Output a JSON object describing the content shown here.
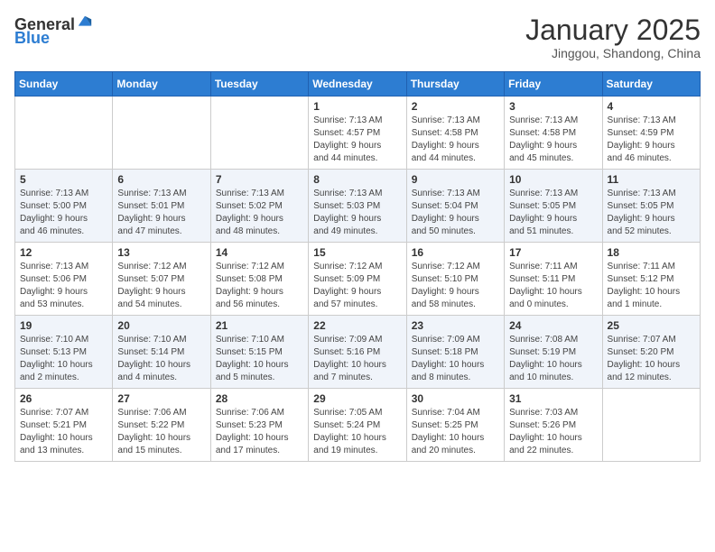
{
  "header": {
    "logo_general": "General",
    "logo_blue": "Blue",
    "month_title": "January 2025",
    "location": "Jinggou, Shandong, China"
  },
  "days_of_week": [
    "Sunday",
    "Monday",
    "Tuesday",
    "Wednesday",
    "Thursday",
    "Friday",
    "Saturday"
  ],
  "weeks": [
    [
      {
        "day": "",
        "info": ""
      },
      {
        "day": "",
        "info": ""
      },
      {
        "day": "",
        "info": ""
      },
      {
        "day": "1",
        "info": "Sunrise: 7:13 AM\nSunset: 4:57 PM\nDaylight: 9 hours\nand 44 minutes."
      },
      {
        "day": "2",
        "info": "Sunrise: 7:13 AM\nSunset: 4:58 PM\nDaylight: 9 hours\nand 44 minutes."
      },
      {
        "day": "3",
        "info": "Sunrise: 7:13 AM\nSunset: 4:58 PM\nDaylight: 9 hours\nand 45 minutes."
      },
      {
        "day": "4",
        "info": "Sunrise: 7:13 AM\nSunset: 4:59 PM\nDaylight: 9 hours\nand 46 minutes."
      }
    ],
    [
      {
        "day": "5",
        "info": "Sunrise: 7:13 AM\nSunset: 5:00 PM\nDaylight: 9 hours\nand 46 minutes."
      },
      {
        "day": "6",
        "info": "Sunrise: 7:13 AM\nSunset: 5:01 PM\nDaylight: 9 hours\nand 47 minutes."
      },
      {
        "day": "7",
        "info": "Sunrise: 7:13 AM\nSunset: 5:02 PM\nDaylight: 9 hours\nand 48 minutes."
      },
      {
        "day": "8",
        "info": "Sunrise: 7:13 AM\nSunset: 5:03 PM\nDaylight: 9 hours\nand 49 minutes."
      },
      {
        "day": "9",
        "info": "Sunrise: 7:13 AM\nSunset: 5:04 PM\nDaylight: 9 hours\nand 50 minutes."
      },
      {
        "day": "10",
        "info": "Sunrise: 7:13 AM\nSunset: 5:05 PM\nDaylight: 9 hours\nand 51 minutes."
      },
      {
        "day": "11",
        "info": "Sunrise: 7:13 AM\nSunset: 5:05 PM\nDaylight: 9 hours\nand 52 minutes."
      }
    ],
    [
      {
        "day": "12",
        "info": "Sunrise: 7:13 AM\nSunset: 5:06 PM\nDaylight: 9 hours\nand 53 minutes."
      },
      {
        "day": "13",
        "info": "Sunrise: 7:12 AM\nSunset: 5:07 PM\nDaylight: 9 hours\nand 54 minutes."
      },
      {
        "day": "14",
        "info": "Sunrise: 7:12 AM\nSunset: 5:08 PM\nDaylight: 9 hours\nand 56 minutes."
      },
      {
        "day": "15",
        "info": "Sunrise: 7:12 AM\nSunset: 5:09 PM\nDaylight: 9 hours\nand 57 minutes."
      },
      {
        "day": "16",
        "info": "Sunrise: 7:12 AM\nSunset: 5:10 PM\nDaylight: 9 hours\nand 58 minutes."
      },
      {
        "day": "17",
        "info": "Sunrise: 7:11 AM\nSunset: 5:11 PM\nDaylight: 10 hours\nand 0 minutes."
      },
      {
        "day": "18",
        "info": "Sunrise: 7:11 AM\nSunset: 5:12 PM\nDaylight: 10 hours\nand 1 minute."
      }
    ],
    [
      {
        "day": "19",
        "info": "Sunrise: 7:10 AM\nSunset: 5:13 PM\nDaylight: 10 hours\nand 2 minutes."
      },
      {
        "day": "20",
        "info": "Sunrise: 7:10 AM\nSunset: 5:14 PM\nDaylight: 10 hours\nand 4 minutes."
      },
      {
        "day": "21",
        "info": "Sunrise: 7:10 AM\nSunset: 5:15 PM\nDaylight: 10 hours\nand 5 minutes."
      },
      {
        "day": "22",
        "info": "Sunrise: 7:09 AM\nSunset: 5:16 PM\nDaylight: 10 hours\nand 7 minutes."
      },
      {
        "day": "23",
        "info": "Sunrise: 7:09 AM\nSunset: 5:18 PM\nDaylight: 10 hours\nand 8 minutes."
      },
      {
        "day": "24",
        "info": "Sunrise: 7:08 AM\nSunset: 5:19 PM\nDaylight: 10 hours\nand 10 minutes."
      },
      {
        "day": "25",
        "info": "Sunrise: 7:07 AM\nSunset: 5:20 PM\nDaylight: 10 hours\nand 12 minutes."
      }
    ],
    [
      {
        "day": "26",
        "info": "Sunrise: 7:07 AM\nSunset: 5:21 PM\nDaylight: 10 hours\nand 13 minutes."
      },
      {
        "day": "27",
        "info": "Sunrise: 7:06 AM\nSunset: 5:22 PM\nDaylight: 10 hours\nand 15 minutes."
      },
      {
        "day": "28",
        "info": "Sunrise: 7:06 AM\nSunset: 5:23 PM\nDaylight: 10 hours\nand 17 minutes."
      },
      {
        "day": "29",
        "info": "Sunrise: 7:05 AM\nSunset: 5:24 PM\nDaylight: 10 hours\nand 19 minutes."
      },
      {
        "day": "30",
        "info": "Sunrise: 7:04 AM\nSunset: 5:25 PM\nDaylight: 10 hours\nand 20 minutes."
      },
      {
        "day": "31",
        "info": "Sunrise: 7:03 AM\nSunset: 5:26 PM\nDaylight: 10 hours\nand 22 minutes."
      },
      {
        "day": "",
        "info": ""
      }
    ]
  ]
}
